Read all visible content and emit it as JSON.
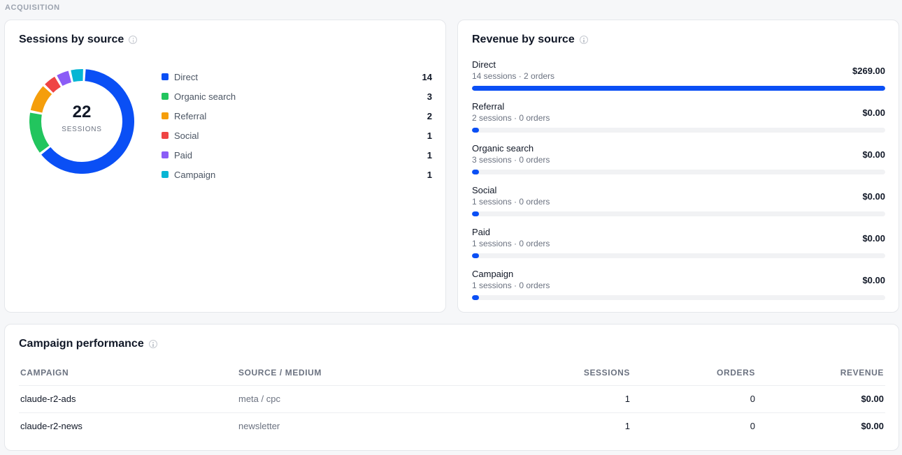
{
  "section": {
    "label": "ACQUISITION"
  },
  "sessions_card": {
    "title": "Sessions by source",
    "total": "22",
    "total_label": "SESSIONS",
    "sources": [
      {
        "label": "Direct",
        "value": 14,
        "color": "#0a4ff5"
      },
      {
        "label": "Organic search",
        "value": 3,
        "color": "#22c55e"
      },
      {
        "label": "Referral",
        "value": 2,
        "color": "#f59e0b"
      },
      {
        "label": "Social",
        "value": 1,
        "color": "#ef4444"
      },
      {
        "label": "Paid",
        "value": 1,
        "color": "#8b5cf6"
      },
      {
        "label": "Campaign",
        "value": 1,
        "color": "#06b6d4"
      }
    ]
  },
  "revenue_card": {
    "title": "Revenue by source",
    "rows": [
      {
        "name": "Direct",
        "meta": "14 sessions · 2 orders",
        "amount": "$269.00",
        "share": 1.0
      },
      {
        "name": "Referral",
        "meta": "2 sessions · 0 orders",
        "amount": "$0.00",
        "share": 0
      },
      {
        "name": "Organic search",
        "meta": "3 sessions · 0 orders",
        "amount": "$0.00",
        "share": 0
      },
      {
        "name": "Social",
        "meta": "1 sessions · 0 orders",
        "amount": "$0.00",
        "share": 0
      },
      {
        "name": "Paid",
        "meta": "1 sessions · 0 orders",
        "amount": "$0.00",
        "share": 0
      },
      {
        "name": "Campaign",
        "meta": "1 sessions · 0 orders",
        "amount": "$0.00",
        "share": 0
      }
    ]
  },
  "campaign_card": {
    "title": "Campaign performance",
    "columns": [
      "CAMPAIGN",
      "SOURCE / MEDIUM",
      "SESSIONS",
      "ORDERS",
      "REVENUE"
    ],
    "rows": [
      {
        "campaign": "claude-r2-ads",
        "source": "meta / cpc",
        "sessions": "1",
        "orders": "0",
        "revenue": "$0.00"
      },
      {
        "campaign": "claude-r2-news",
        "source": "newsletter",
        "sessions": "1",
        "orders": "0",
        "revenue": "$0.00"
      }
    ]
  },
  "colors": {
    "accent": "#0a4ff5",
    "track": "#f1f2f4"
  }
}
